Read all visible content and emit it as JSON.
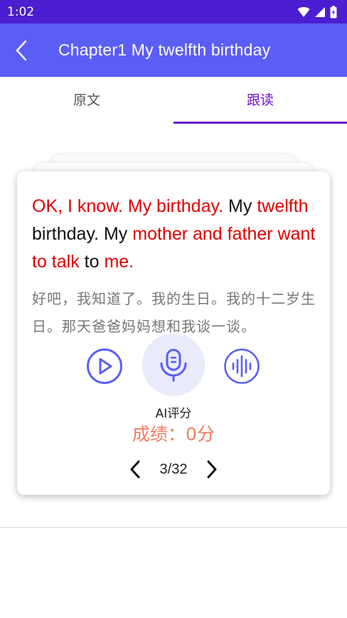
{
  "status_bar": {
    "time": "1:02",
    "icons": [
      "wifi-icon",
      "cellular-signal-icon",
      "battery-icon"
    ]
  },
  "app_bar": {
    "back_icon": "chevron-left-icon",
    "title": "Chapter1   My twelfth birthday",
    "background": "#5b5ef5"
  },
  "tabs": [
    {
      "label": "原文",
      "active": false
    },
    {
      "label": "跟读",
      "active": true
    }
  ],
  "card": {
    "english_segments": [
      {
        "text": "OK, I know. My birthday.",
        "highlight": true
      },
      {
        "text": " My ",
        "highlight": false
      },
      {
        "text": "twelfth",
        "highlight": true
      },
      {
        "text": " birthday. My ",
        "highlight": false
      },
      {
        "text": "mother and father want to talk",
        "highlight": true
      },
      {
        "text": " to ",
        "highlight": false
      },
      {
        "text": "me.",
        "highlight": true
      }
    ],
    "chinese": "好吧，我知道了。我的生日。我的十二岁生日。那天爸爸妈妈想和我谈一谈。",
    "controls": {
      "play_icon": "play-circle-icon",
      "mic_icon": "microphone-icon",
      "wave_icon": "audio-wave-icon"
    },
    "ai_label": "AI评分",
    "score": "成绩：0分",
    "pager": {
      "prev_icon": "chevron-left-icon",
      "text": "3/32",
      "next_icon": "chevron-right-icon"
    }
  },
  "colors": {
    "highlight": "#e00000",
    "accent": "#5b5ef5",
    "tab_active": "#6a12d6",
    "score": "#f27d5e"
  }
}
